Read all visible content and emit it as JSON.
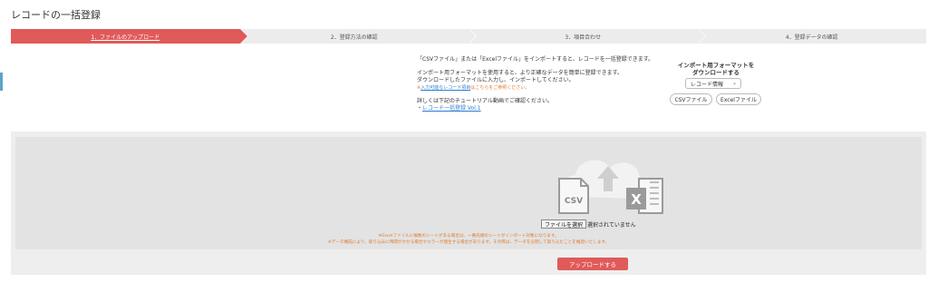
{
  "page": {
    "title": "レコードの一括登録"
  },
  "stepper": {
    "steps": [
      {
        "label": "1．ファイルのアップロード",
        "active": true
      },
      {
        "label": "2．登録方法の確認",
        "active": false
      },
      {
        "label": "3．項目合わせ",
        "active": false
      },
      {
        "label": "4．登録データの確認",
        "active": false
      }
    ]
  },
  "instructions": {
    "line1": "「CSVファイル」または「Excelファイル」をインポートすると、レコードを一括登録できます。",
    "line2": "インポート用フォーマットを使用すると、より正確なデータを簡単に登録できます。",
    "line3": "ダウンロードしたファイルに入力し、インポートしてください。",
    "note_prefix": "※",
    "note_link": "入力可能なレコード項目",
    "note_suffix": "はこちらをご参照ください。",
    "tutorial_text": "詳しくは下記のチュートリアル動画でご確認ください。",
    "tutorial_bullet": "・",
    "tutorial_link": "レコード一括登録 Vol.1"
  },
  "format": {
    "heading_line1": "インポート用フォーマットを",
    "heading_line2": "ダウンロードする",
    "select_value": "レコード情報",
    "csv_button": "CSVファイル",
    "excel_button": "Excelファイル"
  },
  "upload": {
    "file_button": "ファイルを選択",
    "file_status": "選択されていません",
    "warning1": "※Excelファイルに複数のシートがある場合は、一番先頭のシートがインポート対象になります。",
    "warning2": "※データ構成により、取り込みに時間がかかる場合やエラーが発生する場合があります。その際は、データを分割して取り込むことを推奨いたします。",
    "submit_button": "アップロードする",
    "csv_label": "CSV",
    "excel_label": "X"
  },
  "colors": {
    "accent": "#e05a5a",
    "link": "#2a7bd3",
    "warning": "#e07b2f"
  }
}
